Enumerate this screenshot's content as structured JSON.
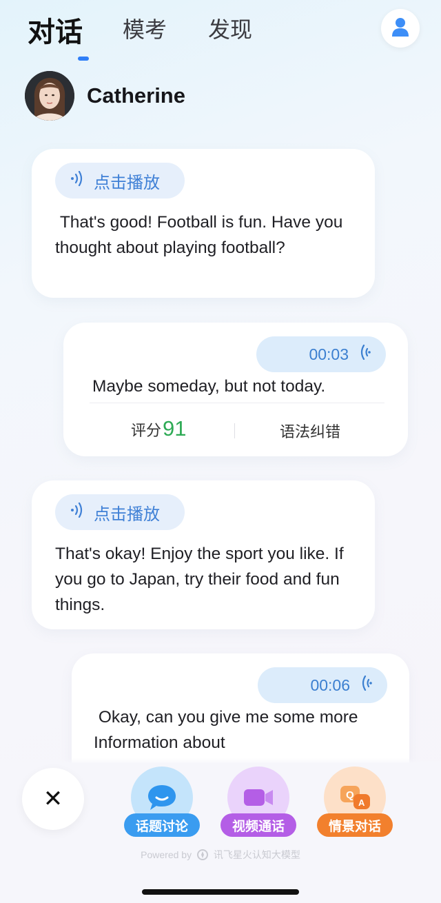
{
  "tabs": [
    {
      "label": "对话",
      "active": true
    },
    {
      "label": "模考",
      "active": false
    },
    {
      "label": "发现",
      "active": false
    }
  ],
  "profile": {
    "name": "Catherine"
  },
  "messages": [
    {
      "role": "bot",
      "play_label": "点击播放",
      "text": " That's good! Football is fun. Have you thought about playing football?"
    },
    {
      "role": "user",
      "duration": "00:03",
      "text": "Maybe someday, but not today.",
      "score_label": "评分",
      "score": "91",
      "grammar_label": "语法纠错"
    },
    {
      "role": "bot",
      "play_label": "点击播放",
      "text": "That's okay! Enjoy the sport you like. If you go to Japan, try their food and fun things."
    },
    {
      "role": "user",
      "duration": "00:06",
      "text": " Okay, can you give me some more Information about"
    }
  ],
  "bottom": {
    "close_icon": "✕",
    "features": [
      {
        "label": "话题讨论",
        "icon": "chat-bubble-icon",
        "color": "#3a9cf0"
      },
      {
        "label": "视频通话",
        "icon": "video-camera-icon",
        "color": "#b45ee6"
      },
      {
        "label": "情景对话",
        "icon": "qa-icon",
        "color": "#f2802d"
      }
    ],
    "powered_prefix": "Powered by",
    "powered_brand": "讯飞星火认知大模型"
  },
  "colors": {
    "accent": "#2f7ef7",
    "score_green": "#2eaa55",
    "link_blue": "#3f80d6"
  }
}
